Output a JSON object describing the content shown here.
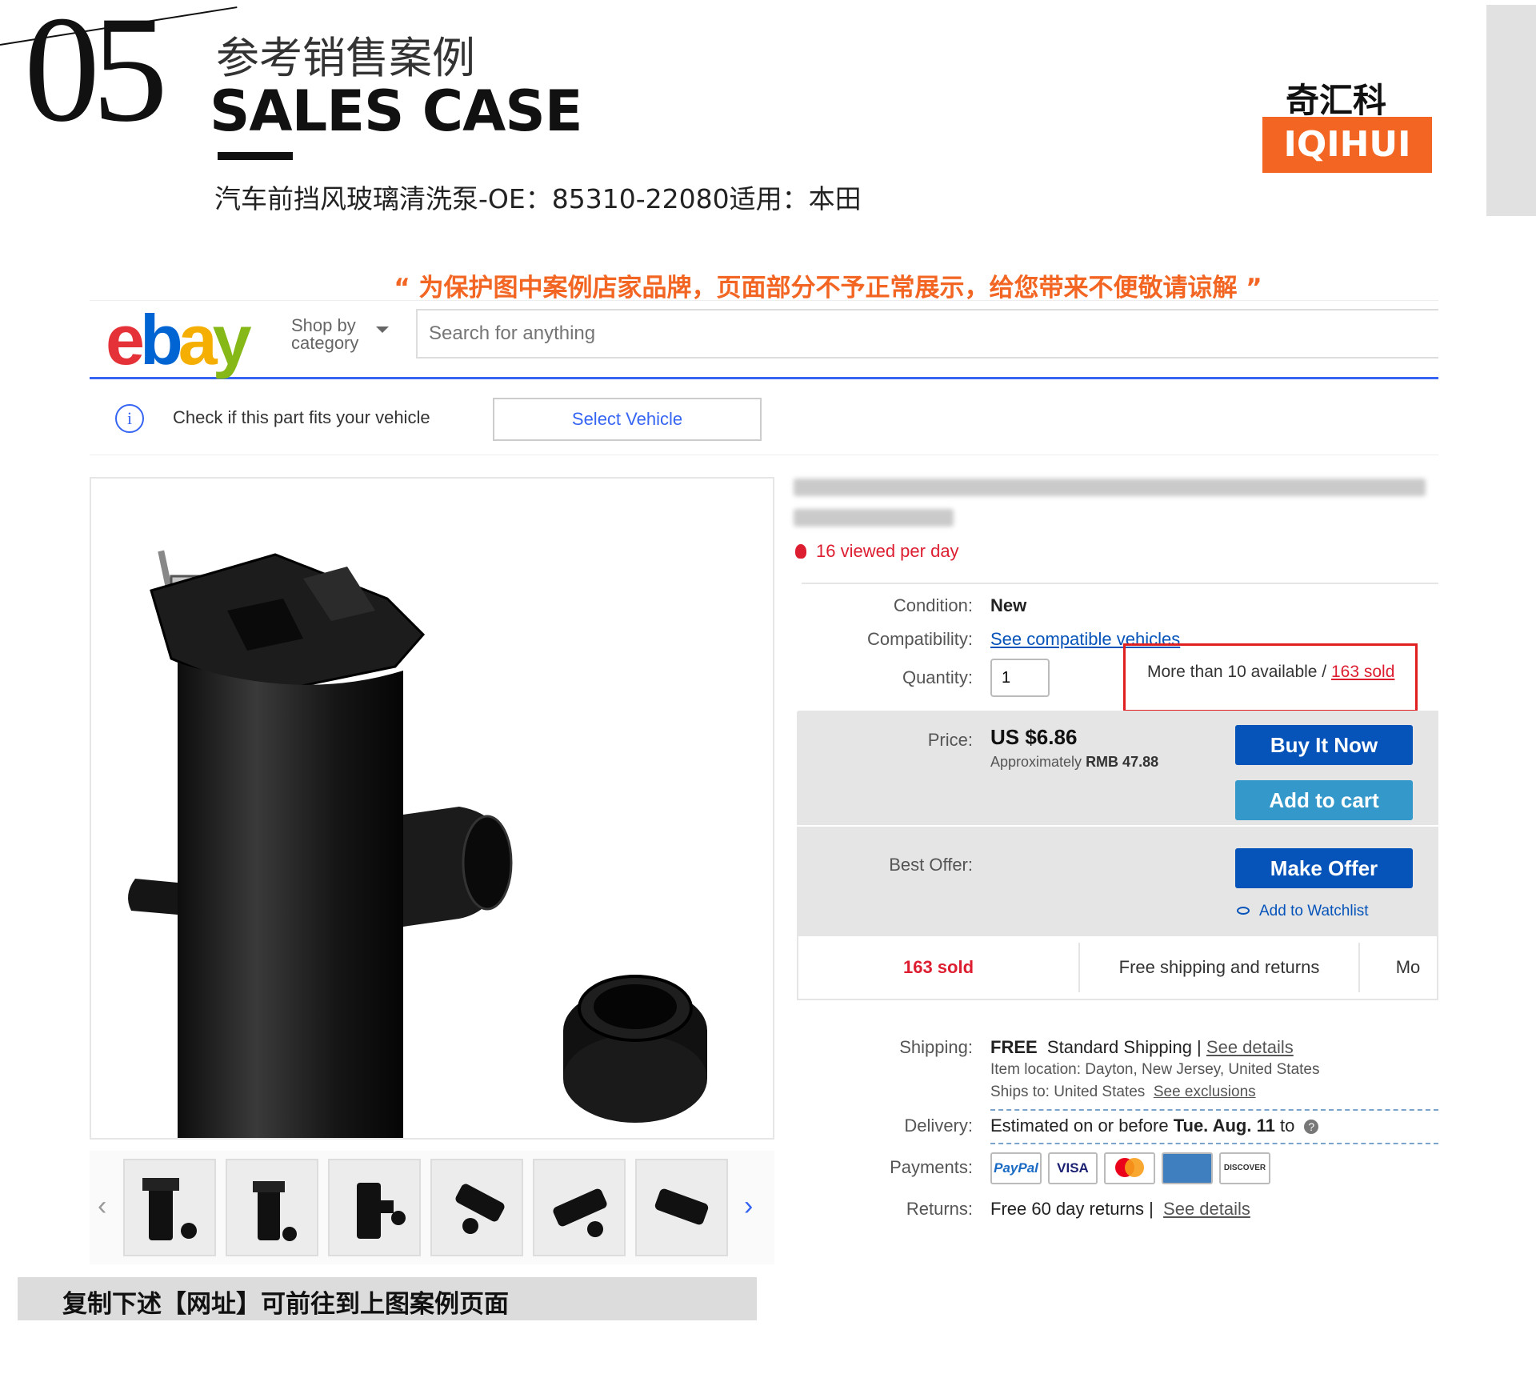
{
  "header": {
    "number": "05",
    "subtitle_cn": "参考销售案例",
    "title_en": "SALES CASE",
    "product_line": "汽车前挡风玻璃清洗泵-OE：85310-22080适用：本田",
    "brand_cn": "奇汇科技",
    "brand_en": "IQIHUI",
    "notice": "“ 为保护图中案例店家品牌，页面部分不予正常展示，给您带来不便敬请谅解 ”"
  },
  "colors": {
    "accent_orange": "#f26522",
    "ebay_blue": "#0654ba",
    "ebay_light_blue": "#3498ca",
    "sold_red": "#dd1e31",
    "highlight_red": "#e02020"
  },
  "ebay": {
    "logo": {
      "e": "e",
      "b": "b",
      "a": "a",
      "y": "y"
    },
    "shop_by": "Shop by",
    "category": "category",
    "search_placeholder": "Search for anything",
    "fit_text": "Check if this part fits your vehicle",
    "select_vehicle": "Select Vehicle",
    "viewed": "16 viewed per day",
    "condition_label": "Condition:",
    "condition_value": "New",
    "compat_label": "Compatibility:",
    "compat_link": "See compatible vehicles",
    "quantity_label": "Quantity:",
    "quantity_value": "1",
    "availability": "More than 10 available / ",
    "sold_link": "163 sold",
    "price_label": "Price:",
    "price": "US $6.86",
    "approx_prefix": "Approximately",
    "approx_value": "RMB 47.88",
    "buy_now": "Buy It Now",
    "add_to_cart": "Add to cart",
    "best_offer_label": "Best Offer:",
    "make_offer": "Make Offer",
    "watchlist": "Add to Watchlist",
    "stats": [
      "163 sold",
      "Free shipping and returns",
      "Mo"
    ],
    "shipping_label": "Shipping:",
    "shipping_free": "FREE",
    "shipping_type": "Standard Shipping |",
    "see_details": "See details",
    "item_location": "Item location:  Dayton, New Jersey, United States",
    "ships_to": "Ships to:  United States",
    "see_exclusions": "See exclusions",
    "delivery_label": "Delivery:",
    "delivery_prefix": "Estimated on or before",
    "delivery_date": "Tue. Aug. 11",
    "delivery_suffix": "to",
    "payments_label": "Payments:",
    "payments": [
      "PayPal",
      "VISA",
      "MC",
      "AMEX",
      "DISCOVER"
    ],
    "returns_label": "Returns:",
    "returns_value": "Free 60 day returns |",
    "returns_link": "See details"
  },
  "footer": {
    "copy_text": "复制下述【网址】可前往到上图案例页面"
  }
}
